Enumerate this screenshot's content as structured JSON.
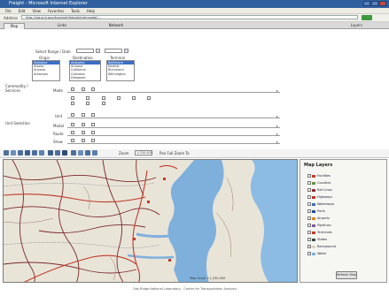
{
  "window": {
    "title": "Freight - Microsoft Internet Explorer"
  },
  "menu": [
    "File",
    "Edit",
    "View",
    "Favorites",
    "Tools",
    "Help"
  ],
  "address": {
    "label": "Address",
    "url": "http://cta.ornl.gov/transnet/freight/intermodal/..."
  },
  "tabs": [
    "Map",
    "Links",
    "Network"
  ],
  "tab_right": "Layers",
  "form": {
    "date_label": "Select Range / Date",
    "lists": [
      {
        "header": "Origin",
        "items": [
          "Alabama",
          "Alaska",
          "Arizona",
          "Arkansas"
        ],
        "selected": 0
      },
      {
        "header": "Destination",
        "items": [
          "Alabama",
          "Arizona",
          "California",
          "Colorado",
          "Delaware"
        ],
        "selected": 0
      },
      {
        "header": "Terminal",
        "items": [
          "Baltimore",
          "Norfolk",
          "Richmond",
          "Wilmington"
        ],
        "selected": 0
      }
    ],
    "sections": [
      {
        "label": "Commodity / Services",
        "rows": [
          {
            "label": "Mode"
          },
          {
            "label": "Unit"
          }
        ]
      },
      {
        "label": "Unit Selection",
        "rows": [
          {
            "label": "Modal"
          },
          {
            "label": "Route"
          },
          {
            "label": "Show"
          }
        ]
      }
    ]
  },
  "maptools": {
    "zoom_label": "Zoom",
    "zoom_value": "1:250,000",
    "right_label": "Pan  Full  Zoom To"
  },
  "map": {
    "note": "Map Scale 1:1,250,000"
  },
  "layers": {
    "title": "Map Layers",
    "items": [
      {
        "label": "Facilities",
        "color": "#c23b2a"
      },
      {
        "label": "Counties",
        "color": "#6a8f3c"
      },
      {
        "label": "Rail Lines",
        "color": "#8a2f2f"
      },
      {
        "label": "Highways",
        "color": "#b8352b"
      },
      {
        "label": "Waterways",
        "color": "#3d6fb4"
      },
      {
        "label": "Ports",
        "color": "#1f4f9a"
      },
      {
        "label": "Airports",
        "color": "#d08a1f"
      },
      {
        "label": "Pipelines",
        "color": "#7a5a9a"
      },
      {
        "label": "Terminals",
        "color": "#c23b2a"
      },
      {
        "label": "States",
        "color": "#444444"
      },
      {
        "label": "Background",
        "color": "#d9d3c0"
      },
      {
        "label": "Water",
        "color": "#7fb0dc"
      }
    ],
    "refresh_label": "Refresh Map"
  },
  "footer": {
    "text": "Oak Ridge National Laboratory - Center for Transportation Analysis"
  }
}
